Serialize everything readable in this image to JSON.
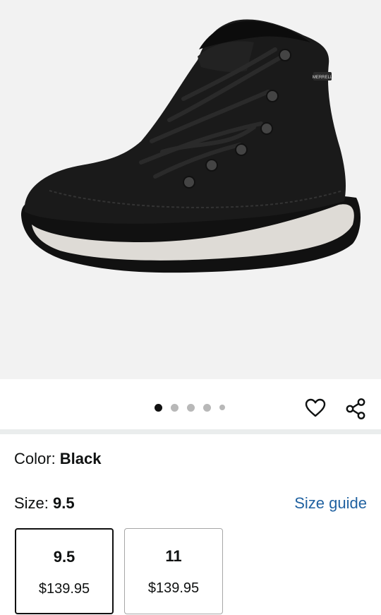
{
  "product_image": {
    "description_icon": "boot-image",
    "brand_tag": "MERRELL"
  },
  "carousel": {
    "dot_count": 5,
    "active_index": 0
  },
  "actions": {
    "wishlist_icon": "heart-icon",
    "share_icon": "share-icon"
  },
  "color": {
    "label": "Color: ",
    "value": "Black"
  },
  "size": {
    "label": "Size: ",
    "value": "9.5",
    "guide_link": "Size guide"
  },
  "size_options": [
    {
      "size": "9.5",
      "price": "$139.95",
      "selected": true
    },
    {
      "size": "11",
      "price": "$139.95",
      "selected": false
    }
  ],
  "colors": {
    "link": "#2162a1",
    "divider": "#eaeded",
    "image_bg": "#f2f2f2"
  }
}
